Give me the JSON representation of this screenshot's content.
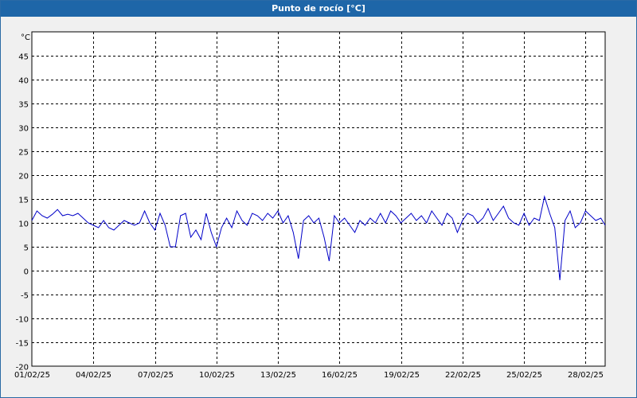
{
  "window": {
    "title": "Punto de rocío [°C]"
  },
  "colors": {
    "titlebar": "#1e66a8",
    "line": "#0000c8",
    "grid": "#000000",
    "plot_bg": "#ffffff"
  },
  "chart_data": {
    "type": "line",
    "title": "Punto de rocío [°C]",
    "ylabel": "°C",
    "xlabel": "",
    "ylim": [
      -20,
      50
    ],
    "yticks": [
      -20,
      -15,
      -10,
      -5,
      0,
      5,
      10,
      15,
      20,
      25,
      30,
      35,
      40,
      45
    ],
    "xlim": [
      "01/02/25 00:00",
      "28/02/25 23:00"
    ],
    "xticks": [
      "01/02/25",
      "04/02/25",
      "07/02/25",
      "10/02/25",
      "13/02/25",
      "16/02/25",
      "19/02/25",
      "22/02/25",
      "25/02/25",
      "28/02/25"
    ],
    "grid": true,
    "grid_style": "dashed",
    "series": [
      {
        "color": "#0000c8",
        "x": [
          "01/02/25 00:00",
          "01/02/25 06:00",
          "01/02/25 12:00",
          "01/02/25 18:00",
          "02/02/25 00:00",
          "02/02/25 06:00",
          "02/02/25 12:00",
          "02/02/25 18:00",
          "03/02/25 00:00",
          "03/02/25 06:00",
          "03/02/25 12:00",
          "03/02/25 18:00",
          "04/02/25 00:00",
          "04/02/25 06:00",
          "04/02/25 12:00",
          "04/02/25 18:00",
          "05/02/25 00:00",
          "05/02/25 06:00",
          "05/02/25 12:00",
          "05/02/25 18:00",
          "06/02/25 00:00",
          "06/02/25 06:00",
          "06/02/25 12:00",
          "06/02/25 18:00",
          "07/02/25 00:00",
          "07/02/25 06:00",
          "07/02/25 12:00",
          "07/02/25 18:00",
          "08/02/25 00:00",
          "08/02/25 06:00",
          "08/02/25 12:00",
          "08/02/25 18:00",
          "09/02/25 00:00",
          "09/02/25 06:00",
          "09/02/25 12:00",
          "09/02/25 18:00",
          "10/02/25 00:00",
          "10/02/25 06:00",
          "10/02/25 12:00",
          "10/02/25 18:00",
          "11/02/25 00:00",
          "11/02/25 06:00",
          "11/02/25 12:00",
          "11/02/25 18:00",
          "12/02/25 00:00",
          "12/02/25 06:00",
          "12/02/25 12:00",
          "12/02/25 18:00",
          "13/02/25 00:00",
          "13/02/25 06:00",
          "13/02/25 12:00",
          "13/02/25 18:00",
          "14/02/25 00:00",
          "14/02/25 06:00",
          "14/02/25 12:00",
          "14/02/25 18:00",
          "15/02/25 00:00",
          "15/02/25 06:00",
          "15/02/25 12:00",
          "15/02/25 18:00",
          "16/02/25 00:00",
          "16/02/25 06:00",
          "16/02/25 12:00",
          "16/02/25 18:00",
          "17/02/25 00:00",
          "17/02/25 06:00",
          "17/02/25 12:00",
          "17/02/25 18:00",
          "18/02/25 00:00",
          "18/02/25 06:00",
          "18/02/25 12:00",
          "18/02/25 18:00",
          "19/02/25 00:00",
          "19/02/25 06:00",
          "19/02/25 12:00",
          "19/02/25 18:00",
          "20/02/25 00:00",
          "20/02/25 06:00",
          "20/02/25 12:00",
          "20/02/25 18:00",
          "21/02/25 00:00",
          "21/02/25 06:00",
          "21/02/25 12:00",
          "21/02/25 18:00",
          "22/02/25 00:00",
          "22/02/25 06:00",
          "22/02/25 12:00",
          "22/02/25 18:00",
          "23/02/25 00:00",
          "23/02/25 06:00",
          "23/02/25 12:00",
          "23/02/25 18:00",
          "24/02/25 00:00",
          "24/02/25 06:00",
          "24/02/25 12:00",
          "24/02/25 18:00",
          "25/02/25 00:00",
          "25/02/25 06:00",
          "25/02/25 12:00",
          "25/02/25 18:00",
          "26/02/25 00:00",
          "26/02/25 06:00",
          "26/02/25 12:00",
          "26/02/25 18:00",
          "27/02/25 00:00",
          "27/02/25 06:00",
          "27/02/25 12:00",
          "27/02/25 18:00",
          "28/02/25 00:00",
          "28/02/25 06:00",
          "28/02/25 12:00",
          "28/02/25 18:00",
          "28/02/25 23:00"
        ],
        "y": [
          10.5,
          12.5,
          11.5,
          11.0,
          11.8,
          12.8,
          11.5,
          11.8,
          11.5,
          12.0,
          11.0,
          10.0,
          9.5,
          9.0,
          10.5,
          9.0,
          8.5,
          9.5,
          10.5,
          10.0,
          9.5,
          10.0,
          12.5,
          10.0,
          8.5,
          12.0,
          9.5,
          5.0,
          5.0,
          11.5,
          12.0,
          7.0,
          8.5,
          6.5,
          12.0,
          8.0,
          5.0,
          9.0,
          11.0,
          9.0,
          12.5,
          10.5,
          9.5,
          12.0,
          11.5,
          10.5,
          12.0,
          11.0,
          12.5,
          10.0,
          11.5,
          8.0,
          2.5,
          10.5,
          11.5,
          10.0,
          11.0,
          7.0,
          2.0,
          11.5,
          10.0,
          11.0,
          9.5,
          8.0,
          10.5,
          9.5,
          11.0,
          10.0,
          12.0,
          10.0,
          12.5,
          11.5,
          10.0,
          11.0,
          12.0,
          10.5,
          11.5,
          10.0,
          12.5,
          11.0,
          9.5,
          12.0,
          11.0,
          8.0,
          10.5,
          12.0,
          11.5,
          10.0,
          11.0,
          13.0,
          10.5,
          12.0,
          13.5,
          11.0,
          10.0,
          9.5,
          12.0,
          9.5,
          11.0,
          10.5,
          15.5,
          12.0,
          9.0,
          -2.0,
          10.5,
          12.5,
          9.0,
          10.0,
          12.5,
          11.5,
          10.5,
          11.0,
          9.5
        ]
      }
    ]
  }
}
